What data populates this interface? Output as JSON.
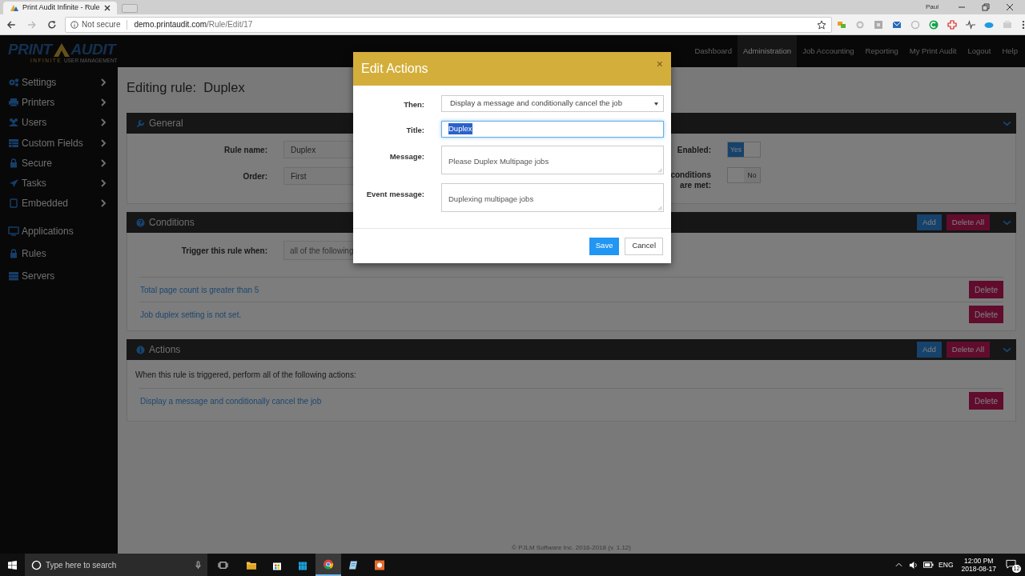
{
  "browser": {
    "tab_title": "Print Audit Infinite - Rule",
    "security": "Not secure",
    "host": "demo.printaudit.com",
    "path": "/Rule/Edit/17",
    "profile": "Paul"
  },
  "logo": {
    "left": "PRINT",
    "right": "AUDIT",
    "tag_1": "INFINITE",
    "tag_2": "USER MANAGEMENT"
  },
  "nav": [
    {
      "label": "Dashboard",
      "selected": false
    },
    {
      "label": "Administration",
      "selected": true
    },
    {
      "label": "Job Accounting",
      "selected": false
    },
    {
      "label": "Reporting",
      "selected": false
    },
    {
      "label": "My Print Audit",
      "selected": false
    },
    {
      "label": "Logout",
      "selected": false
    },
    {
      "label": "Help",
      "selected": false
    }
  ],
  "sidebar": [
    {
      "label": "Settings",
      "has_submenu": true
    },
    {
      "label": "Printers",
      "has_submenu": true
    },
    {
      "label": "Users",
      "has_submenu": true
    },
    {
      "label": "Custom Fields",
      "has_submenu": true
    },
    {
      "label": "Secure",
      "has_submenu": true
    },
    {
      "label": "Tasks",
      "has_submenu": true
    },
    {
      "label": "Embedded",
      "has_submenu": true
    },
    {
      "label": "Applications",
      "has_submenu": false
    },
    {
      "label": "Rules",
      "has_submenu": false
    },
    {
      "label": "Servers",
      "has_submenu": false
    }
  ],
  "page_title": "Editing rule:  Duplex",
  "general": {
    "title": "General",
    "fields": [
      {
        "label": "Rule name:",
        "value": "Duplex"
      },
      {
        "label": "Order:",
        "value": "First"
      }
    ],
    "toggles": [
      {
        "label": "Enabled:",
        "on": true,
        "text": "Yes"
      },
      {
        "label": "conditions are met:",
        "on": false,
        "text": "No"
      }
    ]
  },
  "conditions": {
    "title": "Conditions",
    "add": "Add",
    "delete_all": "Delete All",
    "trigger_label": "Trigger this rule when:",
    "trigger_value": "all of the following",
    "items": [
      {
        "text": "Total page count is greater than 5",
        "delete": "Delete"
      },
      {
        "text": "Job duplex setting is not set.",
        "delete": "Delete"
      }
    ]
  },
  "actions": {
    "title": "Actions",
    "add": "Add",
    "delete_all": "Delete All",
    "intro": "When this rule is triggered, perform all of the following actions:",
    "items": [
      {
        "text": "Display a message and conditionally cancel the job",
        "delete": "Delete"
      }
    ]
  },
  "footer": "© PJLM Software Inc. 2016-2018 (v. 1.12)",
  "modal": {
    "title": "Edit Actions",
    "close": "×",
    "fields": [
      {
        "kind": "select",
        "label": "Then:",
        "value": "Display a message and conditionally cancel the job",
        "focused": false
      },
      {
        "kind": "input",
        "label": "Title:",
        "value": "Duplex",
        "focused": true
      },
      {
        "kind": "textarea",
        "label": "Message:",
        "value": "Please Duplex Multipage jobs",
        "focused": false
      },
      {
        "kind": "textarea",
        "label": "Event message:",
        "value": "Duplexing multipage jobs",
        "focused": false
      }
    ],
    "save": "Save",
    "cancel": "Cancel"
  },
  "taskbar": {
    "search_placeholder": "Type here to search",
    "apps": [
      {
        "selected": false
      },
      {
        "selected": false
      },
      {
        "selected": false
      },
      {
        "selected": true
      },
      {
        "selected": false
      },
      {
        "selected": false
      }
    ],
    "language": "ENG",
    "time": "12:00 PM",
    "date": "2018-08-17",
    "notifications": "12"
  }
}
